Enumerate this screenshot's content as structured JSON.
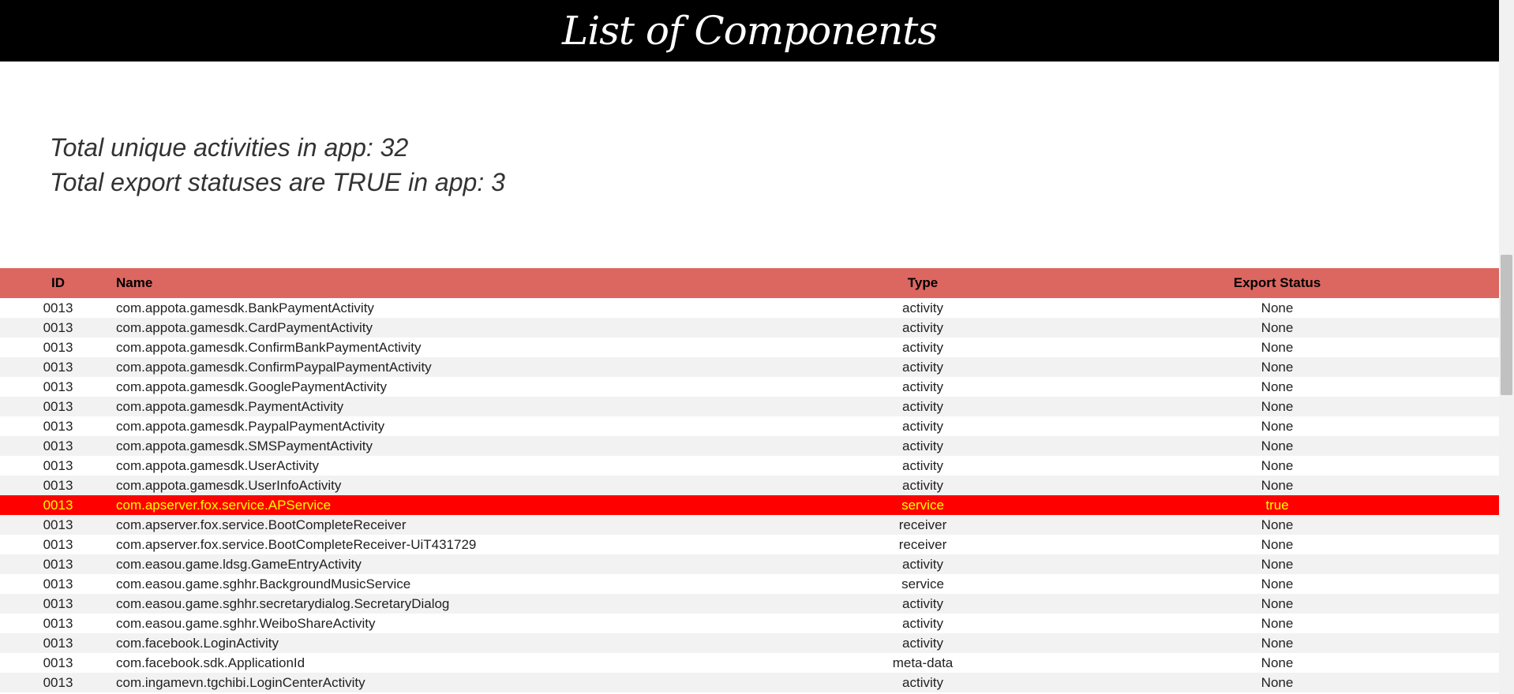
{
  "header": {
    "title": "List of Components"
  },
  "stats": {
    "unique_activities": "Total unique activities in app: 32",
    "export_true": "Total export statuses are TRUE in app: 3"
  },
  "table": {
    "columns": [
      "ID",
      "Name",
      "Type",
      "Export Status"
    ],
    "rows": [
      {
        "id": "0013",
        "name": "com.appota.gamesdk.BankPaymentActivity",
        "type": "activity",
        "export": "None"
      },
      {
        "id": "0013",
        "name": "com.appota.gamesdk.CardPaymentActivity",
        "type": "activity",
        "export": "None"
      },
      {
        "id": "0013",
        "name": "com.appota.gamesdk.ConfirmBankPaymentActivity",
        "type": "activity",
        "export": "None"
      },
      {
        "id": "0013",
        "name": "com.appota.gamesdk.ConfirmPaypalPaymentActivity",
        "type": "activity",
        "export": "None"
      },
      {
        "id": "0013",
        "name": "com.appota.gamesdk.GooglePaymentActivity",
        "type": "activity",
        "export": "None"
      },
      {
        "id": "0013",
        "name": "com.appota.gamesdk.PaymentActivity",
        "type": "activity",
        "export": "None"
      },
      {
        "id": "0013",
        "name": "com.appota.gamesdk.PaypalPaymentActivity",
        "type": "activity",
        "export": "None"
      },
      {
        "id": "0013",
        "name": "com.appota.gamesdk.SMSPaymentActivity",
        "type": "activity",
        "export": "None"
      },
      {
        "id": "0013",
        "name": "com.appota.gamesdk.UserActivity",
        "type": "activity",
        "export": "None"
      },
      {
        "id": "0013",
        "name": "com.appota.gamesdk.UserInfoActivity",
        "type": "activity",
        "export": "None"
      },
      {
        "id": "0013",
        "name": "com.apserver.fox.service.APService",
        "type": "service",
        "export": "true",
        "exported": true
      },
      {
        "id": "0013",
        "name": "com.apserver.fox.service.BootCompleteReceiver",
        "type": "receiver",
        "export": "None"
      },
      {
        "id": "0013",
        "name": "com.apserver.fox.service.BootCompleteReceiver-UiT431729",
        "type": "receiver",
        "export": "None"
      },
      {
        "id": "0013",
        "name": "com.easou.game.ldsg.GameEntryActivity",
        "type": "activity",
        "export": "None"
      },
      {
        "id": "0013",
        "name": "com.easou.game.sghhr.BackgroundMusicService",
        "type": "service",
        "export": "None"
      },
      {
        "id": "0013",
        "name": "com.easou.game.sghhr.secretarydialog.SecretaryDialog",
        "type": "activity",
        "export": "None"
      },
      {
        "id": "0013",
        "name": "com.easou.game.sghhr.WeiboShareActivity",
        "type": "activity",
        "export": "None"
      },
      {
        "id": "0013",
        "name": "com.facebook.LoginActivity",
        "type": "activity",
        "export": "None"
      },
      {
        "id": "0013",
        "name": "com.facebook.sdk.ApplicationId",
        "type": "meta-data",
        "export": "None"
      },
      {
        "id": "0013",
        "name": "com.ingamevn.tgchibi.LoginCenterActivity",
        "type": "activity",
        "export": "None"
      }
    ]
  },
  "colors": {
    "header_bg": "#000000",
    "table_header_bg": "#dc6760",
    "exported_row_bg": "#ff0000",
    "exported_row_text": "#ffff00"
  }
}
